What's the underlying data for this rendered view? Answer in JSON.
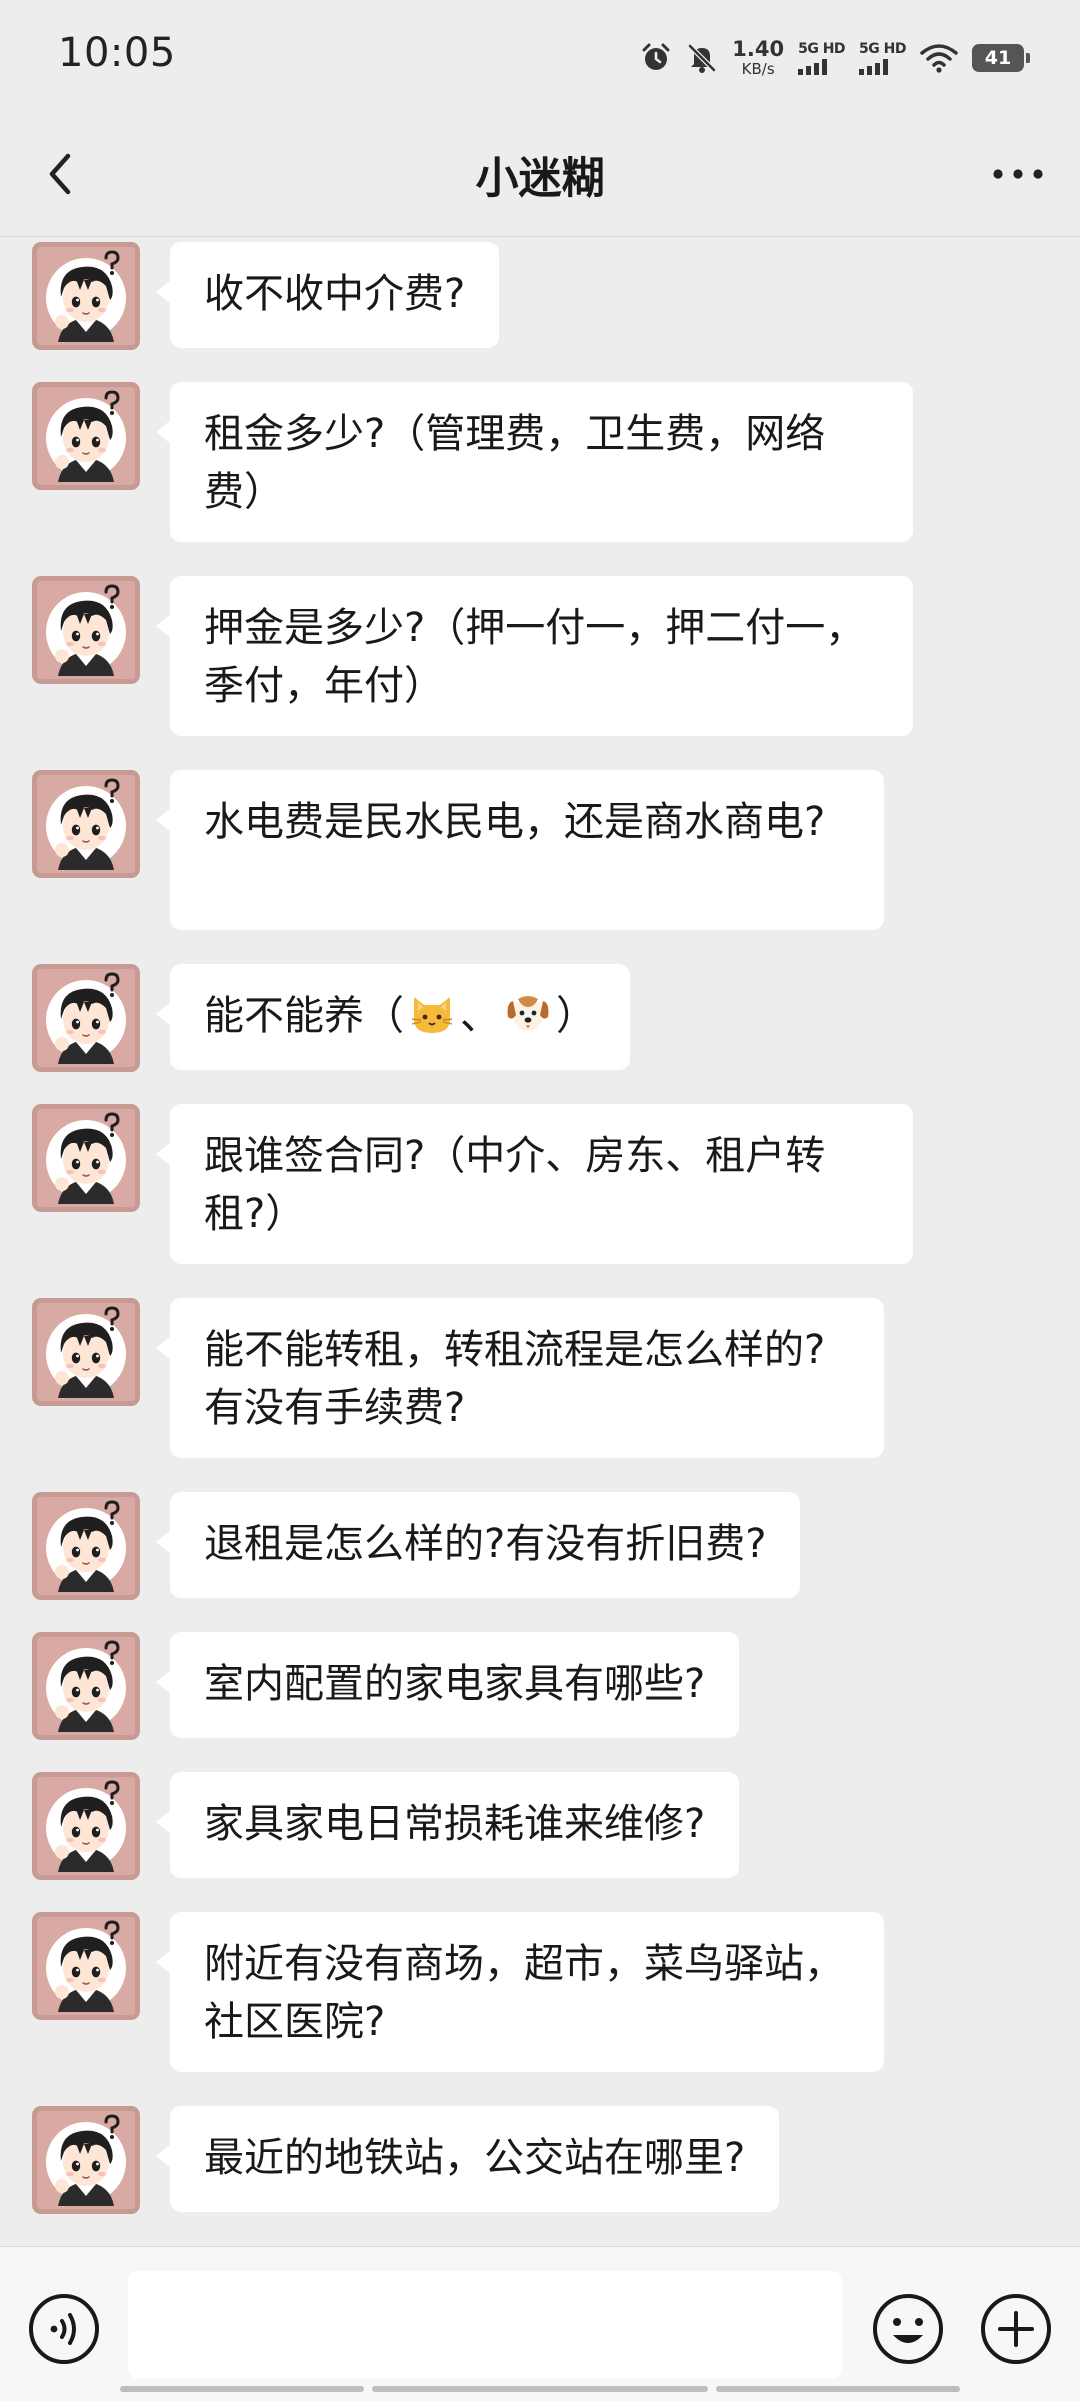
{
  "status_bar": {
    "time": "10:05",
    "net_speed": "1.40",
    "net_speed_unit": "KB/s",
    "sim1_label": "5G HD",
    "sim2_label": "5G HD",
    "battery": "41",
    "icons": [
      "alarm-icon",
      "mute-icon",
      "signal-icon",
      "signal-icon",
      "wifi-icon",
      "battery-icon"
    ]
  },
  "header": {
    "title": "小迷糊",
    "back_icon": "chevron-left-icon",
    "more_icon": "ellipsis-icon"
  },
  "messages": [
    {
      "sender": "self",
      "text": "收不收中介费?"
    },
    {
      "sender": "self",
      "text": "租金多少?（管理费，卫生费，网络费）"
    },
    {
      "sender": "self",
      "text": "押金是多少?（押一付一，押二付一，季付，年付）"
    },
    {
      "sender": "self",
      "text": "水电费是民水民电，还是商水商电?"
    },
    {
      "sender": "self",
      "text_before": "能不能养（",
      "emoji_1": "cat-face-icon",
      "separator": "、",
      "emoji_2": "dog-face-icon",
      "text_after": "）"
    },
    {
      "sender": "self",
      "text": "跟谁签合同?（中介、房东、租户转租?）"
    },
    {
      "sender": "self",
      "text": "能不能转租，转租流程是怎么样的?有没有手续费?"
    },
    {
      "sender": "self",
      "text": "退租是怎么样的?有没有折旧费?"
    },
    {
      "sender": "self",
      "text": "室内配置的家电家具有哪些?"
    },
    {
      "sender": "self",
      "text": "家具家电日常损耗谁来维修?"
    },
    {
      "sender": "self",
      "text": "附近有没有商场，超市，菜鸟驿站，社区医院?"
    },
    {
      "sender": "self",
      "text": "最近的地铁站，公交站在哪里?"
    }
  ],
  "input_bar": {
    "placeholder": "",
    "voice_icon": "voice-icon",
    "emoji_icon": "smile-icon",
    "plus_icon": "plus-circle-icon"
  }
}
